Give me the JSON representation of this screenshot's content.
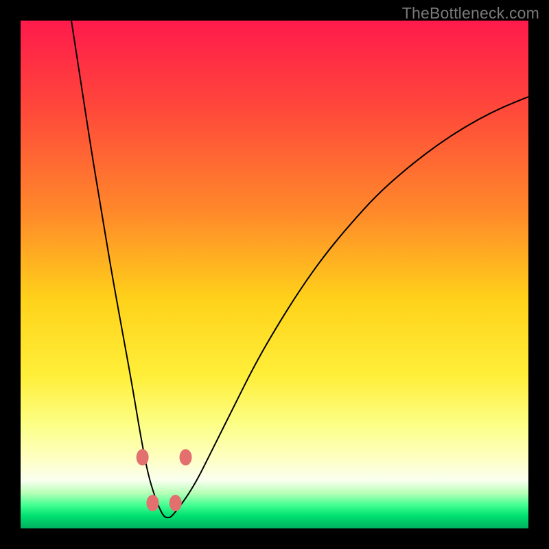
{
  "watermark": "TheBottleneck.com",
  "chart_data": {
    "type": "line",
    "title": "",
    "xlabel": "",
    "ylabel": "",
    "xlim": [
      0,
      100
    ],
    "ylim": [
      0,
      100
    ],
    "grid": false,
    "legend": false,
    "background_gradient": {
      "stops": [
        {
          "pos": 0.0,
          "color": "#ff1a4b"
        },
        {
          "pos": 0.18,
          "color": "#ff4a3a"
        },
        {
          "pos": 0.38,
          "color": "#ff8a2a"
        },
        {
          "pos": 0.55,
          "color": "#ffd21a"
        },
        {
          "pos": 0.7,
          "color": "#ffef3a"
        },
        {
          "pos": 0.8,
          "color": "#fcff8a"
        },
        {
          "pos": 0.86,
          "color": "#feffc0"
        },
        {
          "pos": 0.905,
          "color": "#fafff0"
        },
        {
          "pos": 0.93,
          "color": "#b8ffb8"
        },
        {
          "pos": 0.955,
          "color": "#3fff90"
        },
        {
          "pos": 0.975,
          "color": "#00e070"
        },
        {
          "pos": 1.0,
          "color": "#00b060"
        }
      ]
    },
    "series": [
      {
        "name": "curve",
        "color": "#000000",
        "x": [
          10,
          12,
          14,
          16,
          18,
          20,
          22,
          23.5,
          25,
          26.5,
          28,
          29,
          30,
          34,
          38,
          42,
          46,
          50,
          55,
          60,
          65,
          70,
          75,
          80,
          85,
          90,
          95,
          100
        ],
        "y": [
          100,
          87,
          74,
          62,
          50,
          39,
          28,
          19,
          11,
          6,
          2.5,
          2,
          2.5,
          8,
          16,
          24,
          32,
          39,
          47,
          54,
          60,
          65.5,
          70,
          74,
          77.5,
          80.5,
          83,
          85
        ]
      }
    ],
    "markers": [
      {
        "name": "dot-left-upper",
        "x": 24.0,
        "y": 14.0,
        "color": "#e36f6f"
      },
      {
        "name": "dot-left-lower",
        "x": 26.0,
        "y": 5.0,
        "color": "#e36f6f"
      },
      {
        "name": "dot-right-lower",
        "x": 30.5,
        "y": 5.0,
        "color": "#e36f6f"
      },
      {
        "name": "dot-right-upper",
        "x": 32.5,
        "y": 14.0,
        "color": "#e36f6f"
      }
    ]
  }
}
